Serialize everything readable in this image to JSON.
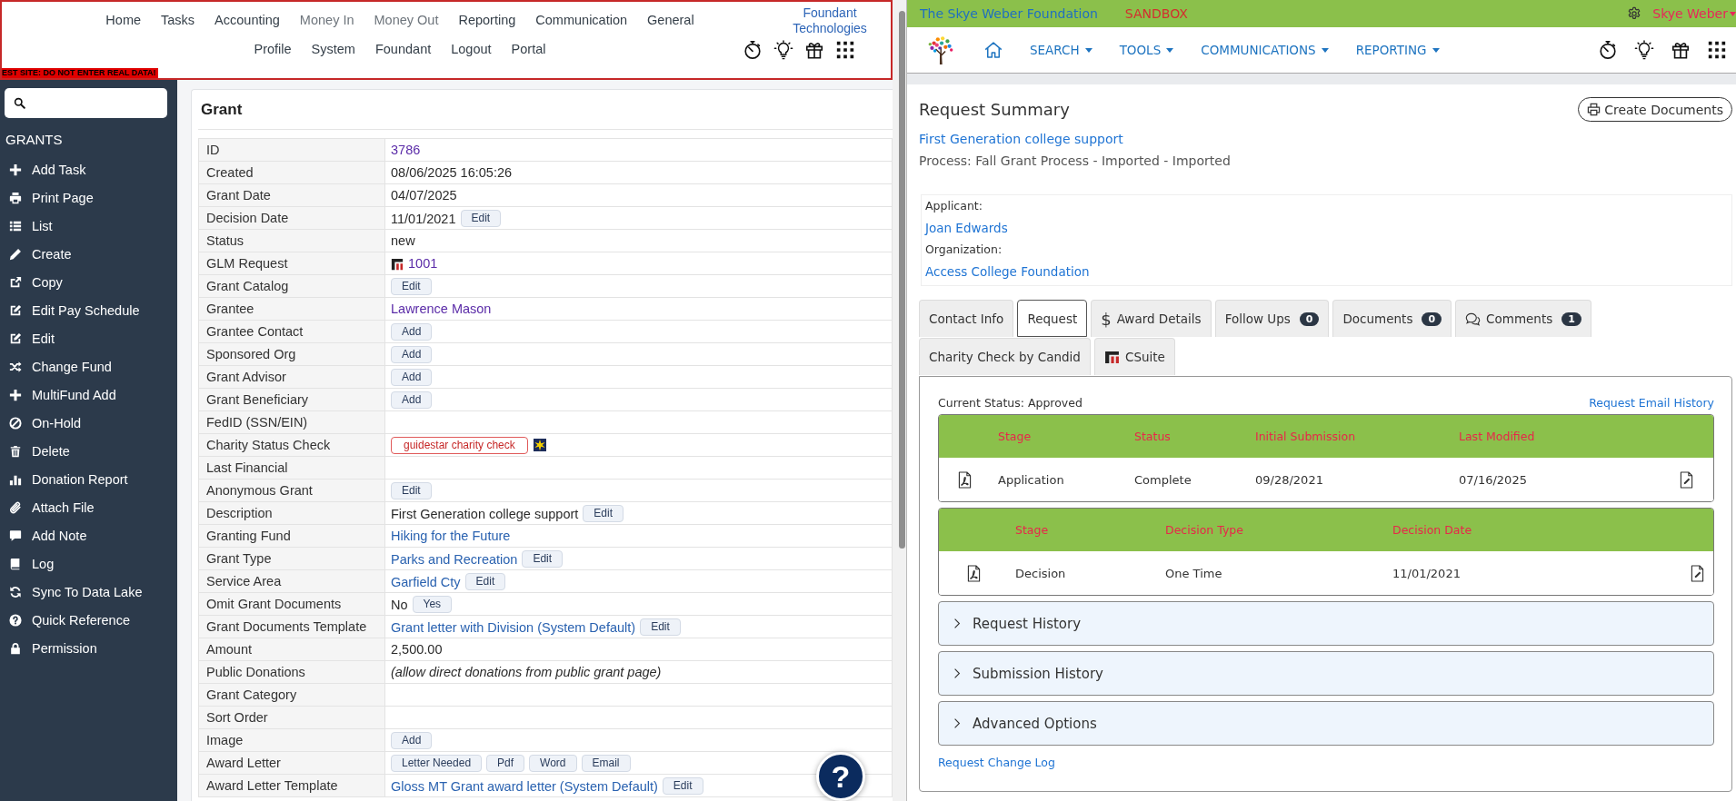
{
  "admin": {
    "nav_rows": [
      [
        {
          "label": "Home",
          "muted": false
        },
        {
          "label": "Tasks",
          "muted": false
        },
        {
          "label": "Accounting",
          "muted": false
        },
        {
          "label": "Money In",
          "muted": true
        },
        {
          "label": "Money Out",
          "muted": true
        },
        {
          "label": "Reporting",
          "muted": false
        },
        {
          "label": "Communication",
          "muted": false
        },
        {
          "label": "General",
          "muted": false
        }
      ],
      [
        {
          "label": "Profile",
          "muted": false
        },
        {
          "label": "System",
          "muted": false
        },
        {
          "label": "Foundant",
          "muted": false
        },
        {
          "label": "Logout",
          "muted": false
        },
        {
          "label": "Portal",
          "muted": false
        }
      ]
    ],
    "brand_link": "Foundant Technologies",
    "test_banner": "EST SITE: DO NOT ENTER REAL DATA!",
    "sidebar": {
      "title": "GRANTS",
      "items": [
        {
          "label": "Add Task",
          "kind": "add"
        },
        {
          "label": "Print Page",
          "kind": "print"
        },
        {
          "label": "List",
          "kind": "list"
        },
        {
          "label": "Create",
          "kind": "create"
        },
        {
          "label": "Copy",
          "kind": "copy"
        },
        {
          "label": "Edit Pay Schedule",
          "kind": "schedule"
        },
        {
          "label": "Edit",
          "kind": "edit"
        },
        {
          "label": "Change Fund",
          "kind": "fund"
        },
        {
          "label": "MultiFund Add",
          "kind": "add"
        },
        {
          "label": "On-Hold",
          "kind": "hold"
        },
        {
          "label": "Delete",
          "kind": "delete"
        },
        {
          "label": "Donation Report",
          "kind": "report"
        },
        {
          "label": "Attach File",
          "kind": "attach"
        },
        {
          "label": "Add Note",
          "kind": "note"
        },
        {
          "label": "Log",
          "kind": "log"
        },
        {
          "label": "Sync To Data Lake",
          "kind": "sync"
        },
        {
          "label": "Quick Reference",
          "kind": "help"
        },
        {
          "label": "Permission",
          "kind": "permission"
        }
      ]
    },
    "grant": {
      "title": "Grant",
      "rows": [
        {
          "label": "ID",
          "parts": [
            {
              "kind": "visited",
              "text": "3786"
            }
          ]
        },
        {
          "label": "Created",
          "parts": [
            {
              "kind": "text",
              "text": "08/06/2025 16:05:26"
            }
          ]
        },
        {
          "label": "Grant Date",
          "parts": [
            {
              "kind": "text",
              "text": "04/07/2025"
            }
          ]
        },
        {
          "label": "Decision Date",
          "parts": [
            {
              "kind": "text",
              "text": "11/01/2021"
            },
            {
              "kind": "button",
              "text": "Edit"
            }
          ]
        },
        {
          "label": "Status",
          "parts": [
            {
              "kind": "text",
              "text": "new"
            }
          ]
        },
        {
          "label": "GLM Request",
          "parts": [
            {
              "kind": "logo"
            },
            {
              "kind": "visited",
              "text": "1001"
            }
          ]
        },
        {
          "label": "Grant Catalog",
          "parts": [
            {
              "kind": "button",
              "text": "Edit"
            }
          ]
        },
        {
          "label": "Grantee",
          "parts": [
            {
              "kind": "visited",
              "text": "Lawrence Mason"
            }
          ]
        },
        {
          "label": "Grantee Contact",
          "parts": [
            {
              "kind": "button",
              "text": "Add"
            }
          ]
        },
        {
          "label": "Sponsored Org",
          "parts": [
            {
              "kind": "button",
              "text": "Add"
            }
          ]
        },
        {
          "label": "Grant Advisor",
          "parts": [
            {
              "kind": "button",
              "text": "Add"
            }
          ]
        },
        {
          "label": "Grant Beneficiary",
          "parts": [
            {
              "kind": "button",
              "text": "Add"
            }
          ]
        },
        {
          "label": "FedID (SSN/EIN)"
        },
        {
          "label": "Charity Status Check",
          "parts": [
            {
              "kind": "alert",
              "text": "guidestar charity check"
            },
            {
              "kind": "star"
            }
          ]
        },
        {
          "label": "Last Financial"
        },
        {
          "label": "Anonymous Grant",
          "parts": [
            {
              "kind": "button",
              "text": "Edit"
            }
          ]
        },
        {
          "label": "Description",
          "parts": [
            {
              "kind": "text",
              "text": "First Generation college support"
            },
            {
              "kind": "button",
              "text": "Edit"
            }
          ]
        },
        {
          "label": "Granting Fund",
          "parts": [
            {
              "kind": "link",
              "text": "Hiking for the Future"
            }
          ]
        },
        {
          "label": "Grant Type",
          "parts": [
            {
              "kind": "link",
              "text": "Parks and Recreation"
            },
            {
              "kind": "button",
              "text": "Edit"
            }
          ]
        },
        {
          "label": "Service Area",
          "parts": [
            {
              "kind": "link",
              "text": "Garfield Cty"
            },
            {
              "kind": "button",
              "text": "Edit"
            }
          ]
        },
        {
          "label": "Omit Grant Documents",
          "parts": [
            {
              "kind": "text",
              "text": "No"
            },
            {
              "kind": "button",
              "text": "Yes"
            }
          ]
        },
        {
          "label": "Grant Documents Template",
          "parts": [
            {
              "kind": "link",
              "text": "Grant letter with Division (System Default)"
            },
            {
              "kind": "button",
              "text": "Edit"
            }
          ]
        },
        {
          "label": "Amount",
          "parts": [
            {
              "kind": "text",
              "text": "2,500.00"
            }
          ]
        },
        {
          "label": "Public Donations",
          "parts": [
            {
              "kind": "note",
              "text": "(allow direct donations from public grant page)"
            }
          ]
        },
        {
          "label": "Grant Category"
        },
        {
          "label": "Sort Order"
        },
        {
          "label": "Image",
          "parts": [
            {
              "kind": "button",
              "text": "Add"
            }
          ]
        },
        {
          "label": "Award Letter",
          "parts": [
            {
              "kind": "button",
              "text": "Letter Needed"
            },
            {
              "kind": "button",
              "text": "Pdf"
            },
            {
              "kind": "button",
              "text": "Word"
            },
            {
              "kind": "button",
              "text": "Email"
            }
          ]
        },
        {
          "label": "Award Letter Template",
          "parts": [
            {
              "kind": "link",
              "text": "Gloss MT Grant award letter (System Default)"
            },
            {
              "kind": "button",
              "text": "Edit"
            }
          ]
        }
      ]
    },
    "help_button": "?"
  },
  "portal": {
    "top_bar": {
      "organization": "The Skye Weber Foundation",
      "environment": "SANDBOX",
      "user": "Skye Weber"
    },
    "menu": [
      {
        "label": "SEARCH"
      },
      {
        "label": "TOOLS"
      },
      {
        "label": "COMMUNICATIONS"
      },
      {
        "label": "REPORTING"
      }
    ],
    "summary": {
      "title": "Request Summary",
      "create_button": "Create Documents",
      "request_name": "First Generation college support",
      "process": "Process: Fall Grant Process - Imported - Imported"
    },
    "contacts": [
      {
        "label": "Applicant:",
        "value": "Joan Edwards"
      },
      {
        "label": "Organization:",
        "value": "Access College Foundation"
      }
    ],
    "tabs": [
      {
        "label": "Contact Info",
        "kind": "plain",
        "selected": false
      },
      {
        "label": "Request",
        "kind": "plain",
        "selected": true
      },
      {
        "label": "Award Details",
        "kind": "plain",
        "symbol": "$",
        "selected": false
      },
      {
        "label": "Follow Ups",
        "kind": "plain",
        "count": "0",
        "selected": false
      },
      {
        "label": "Documents",
        "kind": "plain",
        "count": "0",
        "selected": false
      },
      {
        "label": "Comments",
        "kind": "comments",
        "count": "1",
        "selected": false
      },
      {
        "label": "Charity Check by Candid",
        "kind": "plain",
        "selected": false
      },
      {
        "label": "CSuite",
        "kind": "logo",
        "selected": false
      }
    ],
    "panel": {
      "status": "Current Status: Approved",
      "email_history_link": "Request Email History",
      "stage_tables": [
        {
          "columns": [
            "Stage",
            "Status",
            "Initial Submission",
            "Last Modified"
          ],
          "rows": [
            [
              "Application",
              "Complete",
              "09/28/2021",
              "07/16/2025"
            ]
          ]
        },
        {
          "columns": [
            "Stage",
            "Decision Type",
            "Decision Date"
          ],
          "rows": [
            [
              "Decision",
              "One Time",
              "11/01/2021"
            ]
          ]
        }
      ],
      "sections": [
        {
          "label": "Request History",
          "expanded": false
        },
        {
          "label": "Submission History",
          "expanded": false
        },
        {
          "label": "Advanced Options",
          "expanded": false
        }
      ],
      "change_log_link": "Request Change Log"
    }
  }
}
